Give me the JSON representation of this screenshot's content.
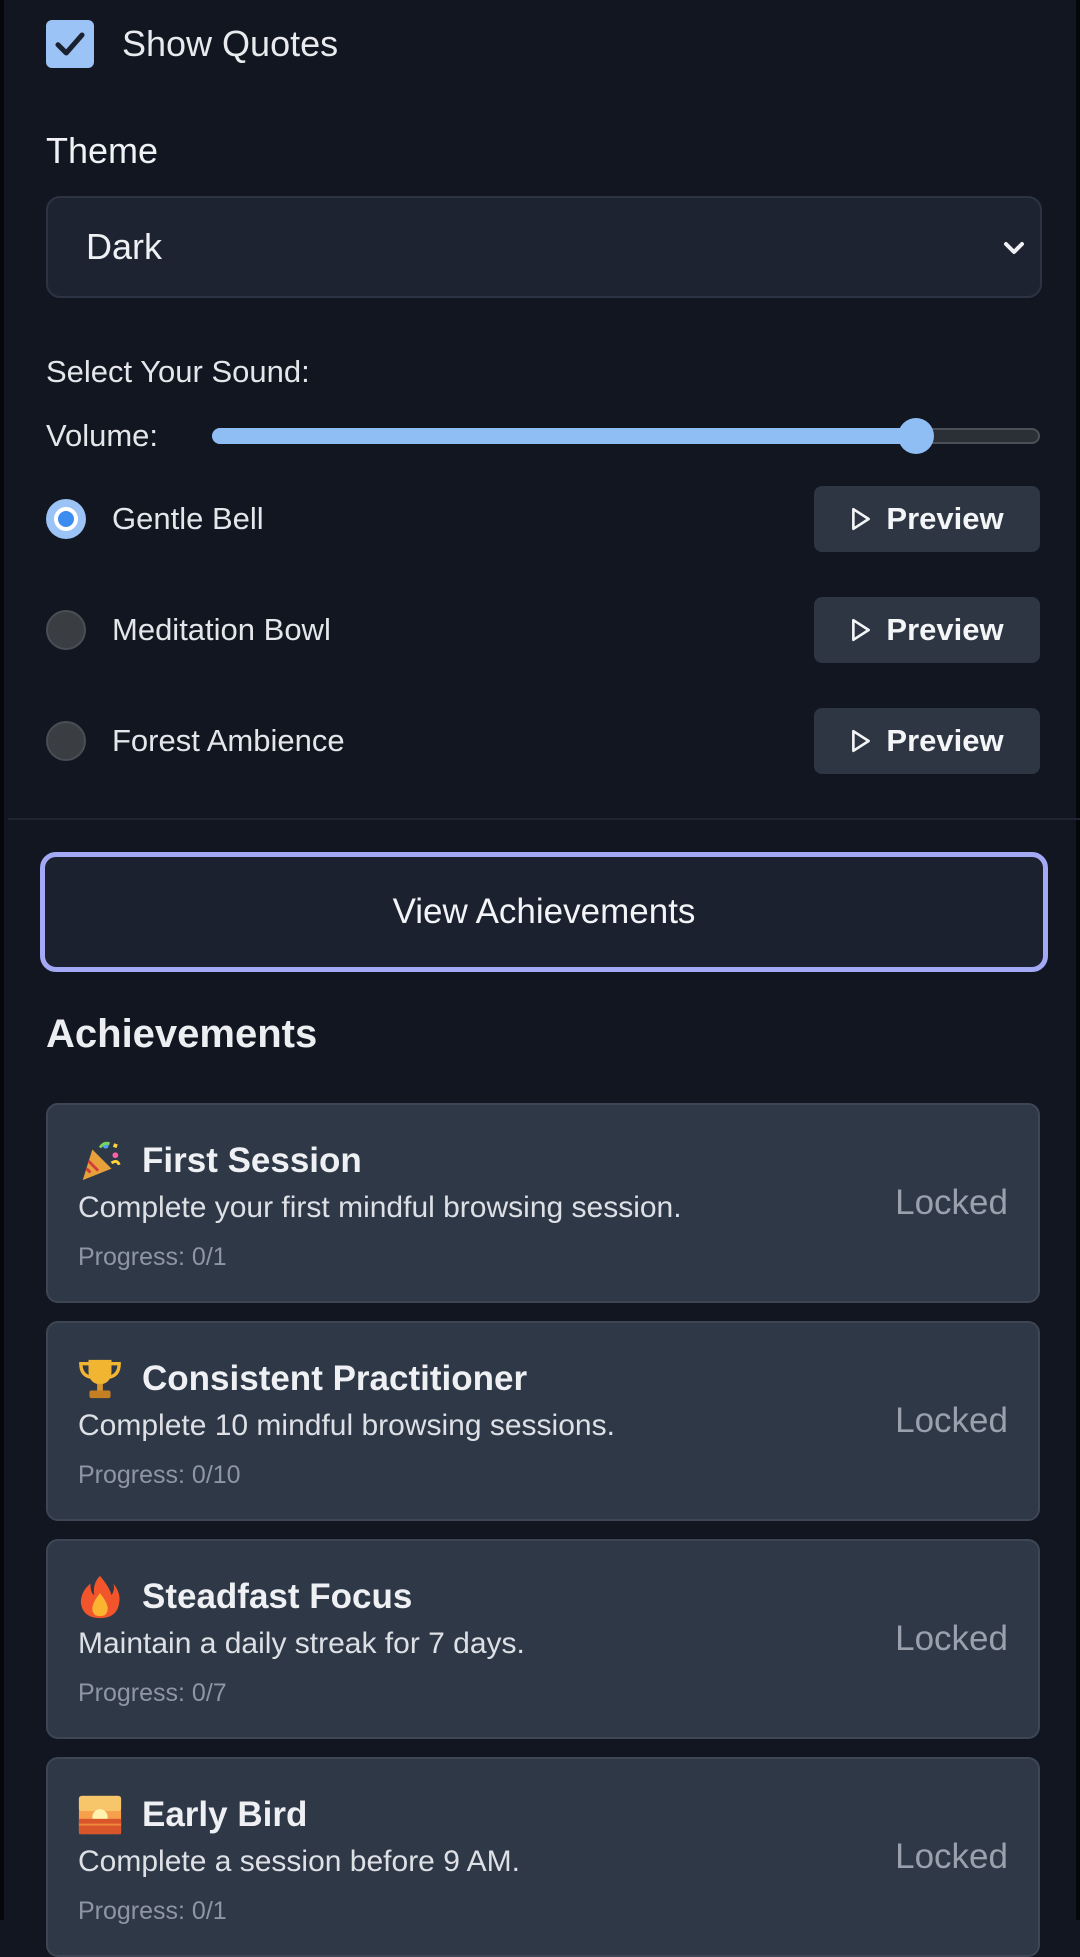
{
  "settings": {
    "show_quotes_label": "Show Quotes",
    "show_quotes_checked": true,
    "theme_label": "Theme",
    "theme_value": "Dark",
    "sound_label": "Select Your Sound:",
    "volume_label": "Volume:",
    "volume_level": 0.85,
    "sounds": [
      {
        "name": "Gentle Bell",
        "selected": true,
        "preview_label": "Preview"
      },
      {
        "name": "Meditation Bowl",
        "selected": false,
        "preview_label": "Preview"
      },
      {
        "name": "Forest Ambience",
        "selected": false,
        "preview_label": "Preview"
      }
    ]
  },
  "view_achievements_label": "View Achievements",
  "achievements": {
    "title": "Achievements",
    "items": [
      {
        "icon": "party-popper-icon",
        "name": "First Session",
        "description": "Complete your first mindful browsing session.",
        "progress": "Progress: 0/1",
        "status": "Locked"
      },
      {
        "icon": "trophy-icon",
        "name": "Consistent Practitioner",
        "description": "Complete 10 mindful browsing sessions.",
        "progress": "Progress: 0/10",
        "status": "Locked"
      },
      {
        "icon": "fire-icon",
        "name": "Steadfast Focus",
        "description": "Maintain a daily streak for 7 days.",
        "progress": "Progress: 0/7",
        "status": "Locked"
      },
      {
        "icon": "sunrise-icon",
        "name": "Early Bird",
        "description": "Complete a session before 9 AM.",
        "progress": "Progress: 0/1",
        "status": "Locked"
      }
    ]
  },
  "colors": {
    "background": "#121621",
    "accent": "#8fbef5",
    "card": "#2f3847",
    "button_outline": "#a3a9f4"
  }
}
